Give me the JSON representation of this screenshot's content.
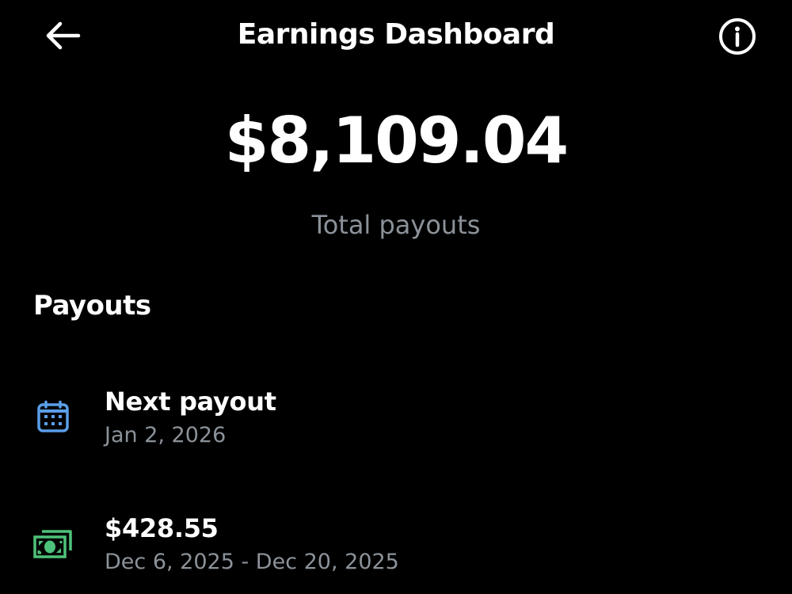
{
  "header": {
    "title": "Earnings Dashboard",
    "back_icon": "arrow-left-icon",
    "info_icon": "info-circle-icon"
  },
  "summary": {
    "total_amount": "$8,109.04",
    "total_label": "Total payouts"
  },
  "payouts": {
    "section_title": "Payouts",
    "items": [
      {
        "icon": "calendar-icon",
        "icon_color": "#5b9ee8",
        "primary": "Next payout",
        "secondary": "Jan 2, 2026"
      },
      {
        "icon": "cash-icon",
        "icon_color": "#4ec27a",
        "primary": "$428.55",
        "secondary": "Dec 6, 2025 - Dec 20, 2025"
      }
    ]
  },
  "colors": {
    "background": "#000000",
    "text_primary": "#ffffff",
    "text_secondary": "#8b9299"
  }
}
